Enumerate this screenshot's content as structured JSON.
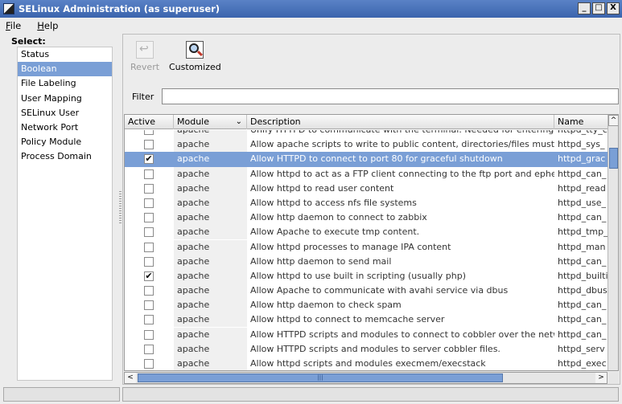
{
  "window": {
    "title": "SELinux Administration (as superuser)",
    "buttons": {
      "minimize": "_",
      "maximize": "□",
      "close": "X"
    }
  },
  "menu": {
    "file": "File",
    "help": "Help"
  },
  "sidebar": {
    "select_label": "Select:",
    "items": [
      {
        "label": "Status"
      },
      {
        "label": "Boolean"
      },
      {
        "label": "File Labeling"
      },
      {
        "label": "User Mapping"
      },
      {
        "label": "SELinux User"
      },
      {
        "label": "Network Port"
      },
      {
        "label": "Policy Module"
      },
      {
        "label": "Process Domain"
      }
    ],
    "selected_index": 1
  },
  "toolbar": {
    "revert_label": "Revert",
    "customized_label": "Customized"
  },
  "filter": {
    "label": "Filter",
    "value": ""
  },
  "table": {
    "headers": {
      "active": "Active",
      "module": "Module",
      "description": "Description",
      "name": "Name"
    },
    "rows": [
      {
        "active": false,
        "module": "apache",
        "description": "Unify HTTPD to communicate with the terminal. Needed for entering t",
        "name": "httpd_tty_c"
      },
      {
        "active": false,
        "module": "apache",
        "description": "Allow apache scripts to write to public content, directories/files must l",
        "name": "httpd_sys_"
      },
      {
        "active": true,
        "module": "apache",
        "description": "Allow HTTPD to connect to port 80 for graceful shutdown",
        "name": "httpd_grac",
        "selected": true
      },
      {
        "active": false,
        "module": "apache",
        "description": "Allow httpd to act as a FTP client connecting to the ftp port and epher",
        "name": "httpd_can_"
      },
      {
        "active": false,
        "module": "apache",
        "description": "Allow httpd to read user content",
        "name": "httpd_read"
      },
      {
        "active": false,
        "module": "apache",
        "description": "Allow httpd to access nfs file systems",
        "name": "httpd_use_"
      },
      {
        "active": false,
        "module": "apache",
        "description": "Allow http daemon to connect to zabbix",
        "name": "httpd_can_"
      },
      {
        "active": false,
        "module": "apache",
        "description": "Allow Apache to execute tmp content.",
        "name": "httpd_tmp_"
      },
      {
        "active": false,
        "module": "apache",
        "description": "Allow httpd processes to manage IPA content",
        "name": "httpd_man"
      },
      {
        "active": false,
        "module": "apache",
        "description": "Allow http daemon to send mail",
        "name": "httpd_can_"
      },
      {
        "active": true,
        "module": "apache",
        "description": "Allow httpd to use built in scripting (usually php)",
        "name": "httpd_builti"
      },
      {
        "active": false,
        "module": "apache",
        "description": "Allow Apache to communicate with avahi service via dbus",
        "name": "httpd_dbus"
      },
      {
        "active": false,
        "module": "apache",
        "description": "Allow http daemon to check spam",
        "name": "httpd_can_"
      },
      {
        "active": false,
        "module": "apache",
        "description": "Allow httpd to connect to memcache server",
        "name": "httpd_can_"
      },
      {
        "active": false,
        "module": "apache",
        "description": "Allow HTTPD scripts and modules to connect to cobbler over the netw",
        "name": "httpd_can_"
      },
      {
        "active": false,
        "module": "apache",
        "description": "Allow HTTPD scripts and modules to server cobbler files.",
        "name": "httpd_serv"
      },
      {
        "active": false,
        "module": "apache",
        "description": "Allow httpd scripts and modules execmem/execstack",
        "name": "httpd_exec"
      }
    ]
  },
  "scroll": {
    "up_arrow": "^",
    "left_arrow": "<",
    "right_arrow": ">",
    "thumb_grip": "|||"
  }
}
